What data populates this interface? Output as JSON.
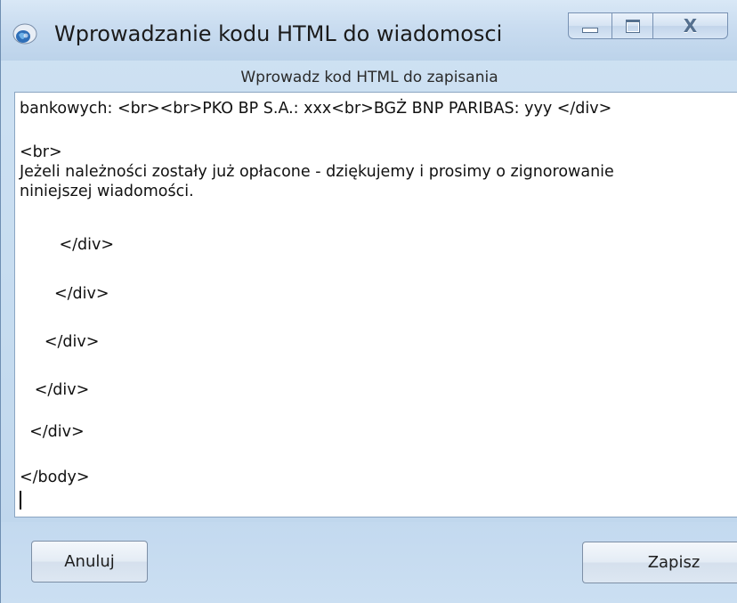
{
  "window": {
    "title": "Wprowadzanie kodu HTML do wiadomosci",
    "app_icon": "email-globe-icon",
    "caption_buttons": {
      "minimize_icon": "minimize-icon",
      "maximize_icon": "maximize-icon",
      "close_icon": "close-icon",
      "close_glyph": "X"
    }
  },
  "prompt": "Wprowadz kod HTML do zapisania",
  "editor": {
    "lines": [
      "bankowych: <br><br>PKO BP S.A.: xxx<br>BGŻ BNP PARIBAS: yyy </div>",
      "<br>",
      "Jeżeli należności zostały już opłacone - dziękujemy i prosimy o zignorowanie",
      "niniejszej wiadomości.",
      "        </div>",
      "       </div>",
      "     </div>",
      "   </div>",
      "  </div>",
      "</body>"
    ]
  },
  "buttons": {
    "cancel_label": "Anuluj",
    "save_label": "Zapisz"
  },
  "colors": {
    "frame": "#c5dbef",
    "editor_bg": "#ffffff",
    "text": "#111111"
  }
}
